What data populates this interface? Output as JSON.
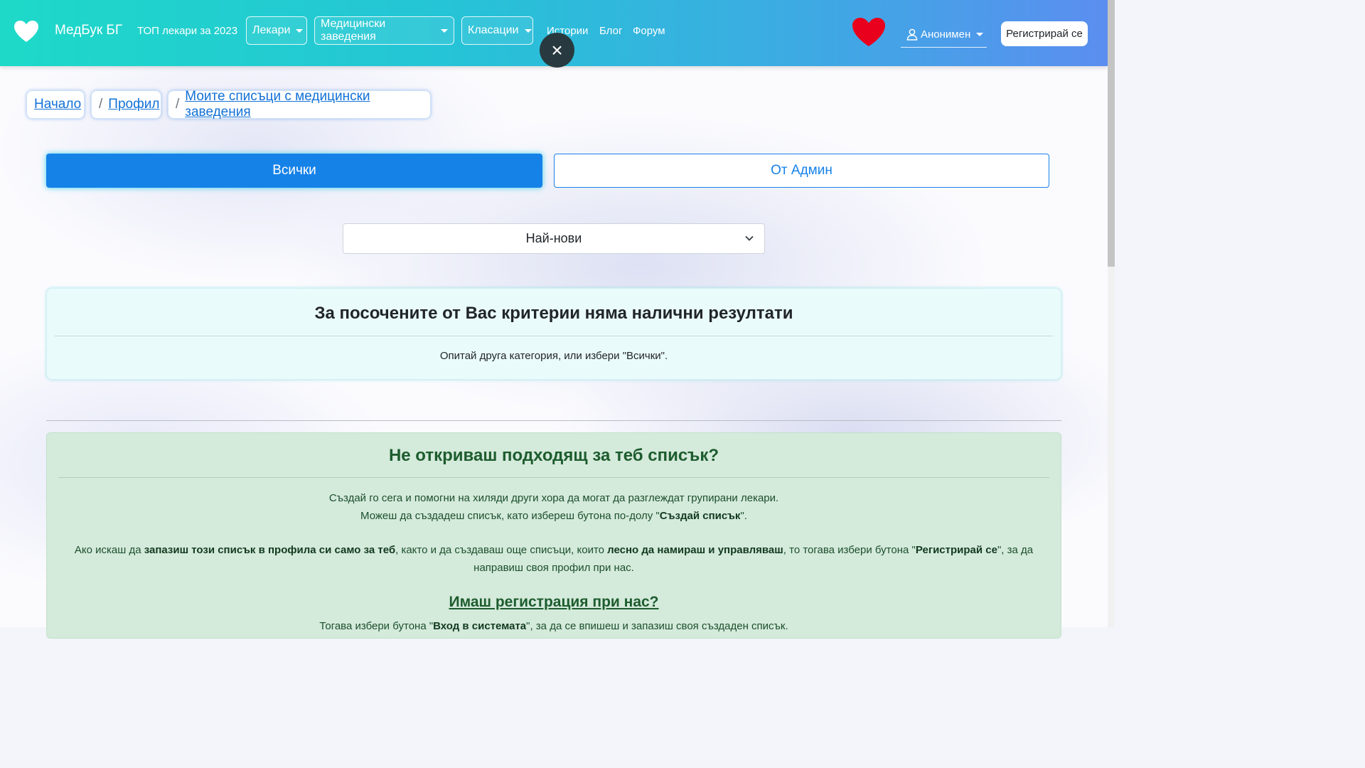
{
  "navbar": {
    "brand": "МедБук БГ",
    "top_doctors": "ТОП лекари за 2023",
    "doctors": "Лекари",
    "institutions": "Медицински заведения",
    "rankings": "Класации",
    "stories": "Истории",
    "blog": "Блог",
    "forum": "Форум",
    "close_symbol": "×",
    "user": "Анонимен",
    "register": "Регистрирай се",
    "colors": {
      "gradient_start": "#1ed9c8",
      "gradient_end": "#5b8ef0",
      "favorite_heart": "#e8001c"
    }
  },
  "breadcrumb": {
    "home": "Начало",
    "profile": "Профил",
    "lists": "Моите списъци с медицински заведения",
    "separator": "/"
  },
  "tabs": {
    "all": "Всички",
    "admin": "От Админ",
    "active_color": "#1582e8"
  },
  "sort": {
    "selected": "Най-нови"
  },
  "no_results": {
    "title": "За посочените от Вас критерии няма налични резултати",
    "message": "Опитай друга категория, или избери \"Всички\"."
  },
  "suggest": {
    "title": "Не откриваш подходящ за теб списък?",
    "line1": "Създай го сега и помогни на хиляди други хора да могат да разглеждат групирани лекари.",
    "line2_prefix": "Можеш да създадеш списък, като избереш бутона по-долу \"",
    "line2_bold": "Създай списък",
    "line2_suffix": "\".",
    "p2_a": "Ако искаш да ",
    "p2_b": "запазиш този списък в профила си само за теб",
    "p2_c": ", както и да създаваш още списъци, които ",
    "p2_d": "лесно да намираш и управляваш",
    "p2_e": ", то тогава избери бутона \"",
    "p2_f": "Регистрирай се",
    "p2_g": "\", за да направиш своя профил при нас.",
    "have_account": "Имаш регистрация при нас?",
    "p3_a": "Тогава избери бутона \"",
    "p3_b": "Вход в системата",
    "p3_c": "\", за да се впишеш и запазиш своя създаден списък."
  }
}
